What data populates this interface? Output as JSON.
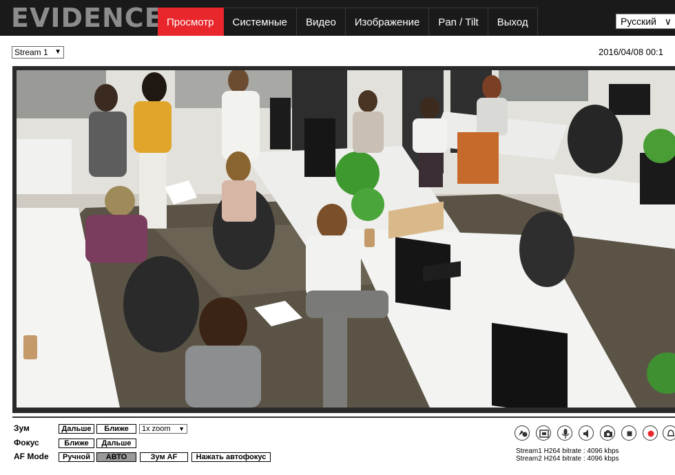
{
  "header": {
    "logo_text": "EVIDENCE",
    "logo_mark": "®",
    "nav": [
      {
        "label": "Просмотр",
        "active": true
      },
      {
        "label": "Системные",
        "active": false
      },
      {
        "label": "Видео",
        "active": false
      },
      {
        "label": "Изображение",
        "active": false
      },
      {
        "label": "Pan / Tilt",
        "active": false
      },
      {
        "label": "Выход",
        "active": false
      }
    ],
    "language": "Русский"
  },
  "subbar": {
    "stream_selected": "Stream 1",
    "datetime": "2016/04/08 00:1"
  },
  "controls": {
    "zoom_label": "Зум",
    "zoom_out": "Дальше",
    "zoom_in": "Ближе",
    "zoom_level": "1x zoom",
    "focus_label": "Фокус",
    "focus_near": "Ближе",
    "focus_far": "Дальше",
    "af_label": "AF Mode",
    "af_manual": "Ручной",
    "af_auto": "АВТО",
    "af_zoom": "Зум AF",
    "af_push": "Нажать автофокус",
    "af_selected": "АВТО"
  },
  "toolbar": {
    "icons": [
      "talk-icon",
      "fullscreen-icon",
      "microphone-icon",
      "speaker-icon",
      "snapshot-icon",
      "stop-icon",
      "record-icon",
      "alarm-icon"
    ],
    "record_color": "#e8262c"
  },
  "status": {
    "stream1": "Stream1 H264 bitrate : 4096 kbps",
    "stream2": "Stream2 H264 bitrate : 4096 kbps"
  },
  "colors": {
    "accent": "#e8262c",
    "header_bg": "#1a1a1a"
  }
}
